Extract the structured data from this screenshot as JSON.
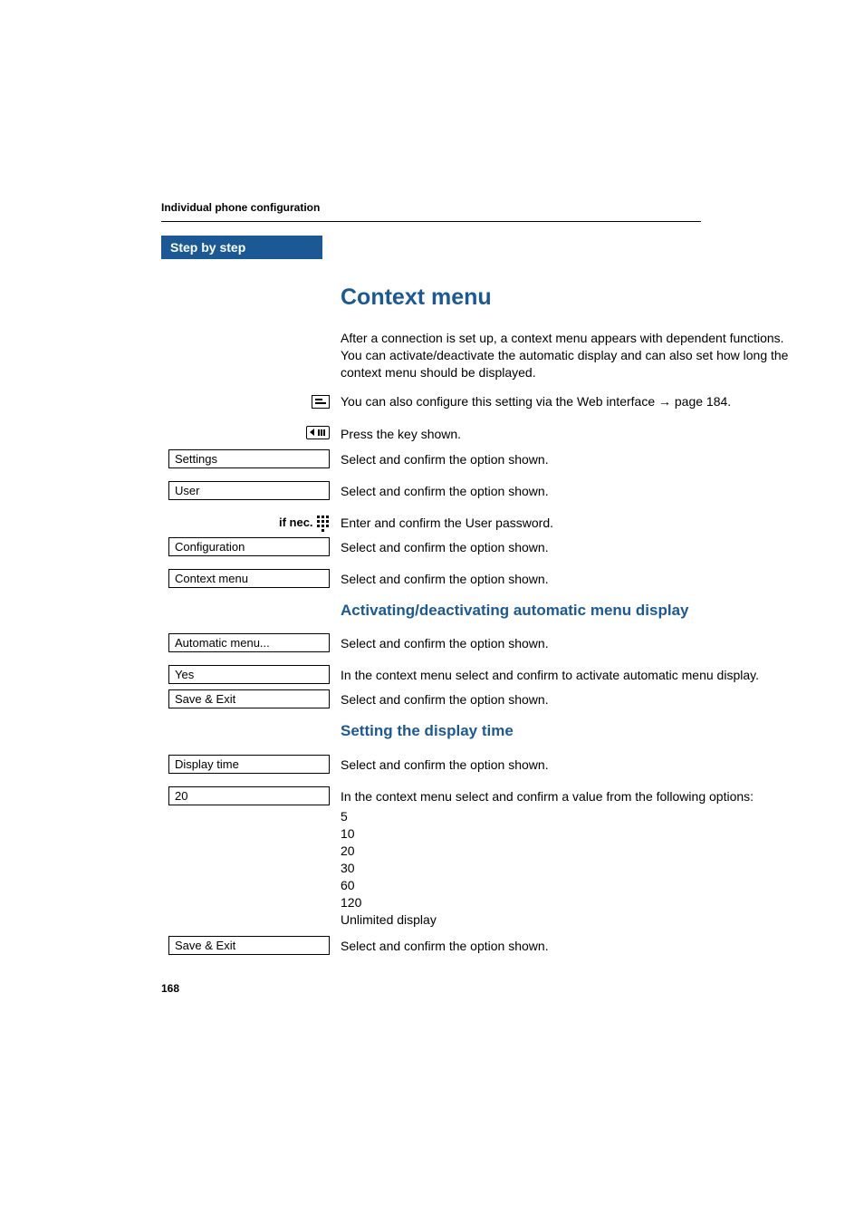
{
  "header": {
    "running_title": "Individual phone configuration",
    "step_banner": "Step by step"
  },
  "section": {
    "title": "Context menu",
    "intro": "After a connection is set up, a context menu appears with dependent functions. You can activate/deactivate the automatic display and can also set how long the context menu should be displayed.",
    "web_note_prefix": "You can also configure this setting via the Web interface ",
    "web_note_arrow": "→",
    "web_note_page": " page 184.",
    "press_key": "Press the key shown.",
    "select_confirm": "Select and confirm the option shown.",
    "if_nec": "if nec.",
    "enter_password": "Enter and confirm the User password."
  },
  "options": {
    "settings": "Settings",
    "user": "User",
    "configuration": "Configuration",
    "context_menu": "Context menu",
    "automatic_menu": "Automatic menu...",
    "yes": "Yes",
    "save_exit": "Save & Exit",
    "display_time": "Display time",
    "value_20": "20"
  },
  "sub_activate": {
    "title": "Activating/deactivating automatic menu display",
    "yes_text": "In the context menu select and confirm to activate automatic menu display."
  },
  "sub_display_time": {
    "title": "Setting the display time",
    "value_intro": "In the context menu select and confirm a value from the following options:",
    "values": [
      "5",
      "10",
      "20",
      "30",
      "60",
      "120",
      "Unlimited display"
    ]
  },
  "page_number": "168"
}
